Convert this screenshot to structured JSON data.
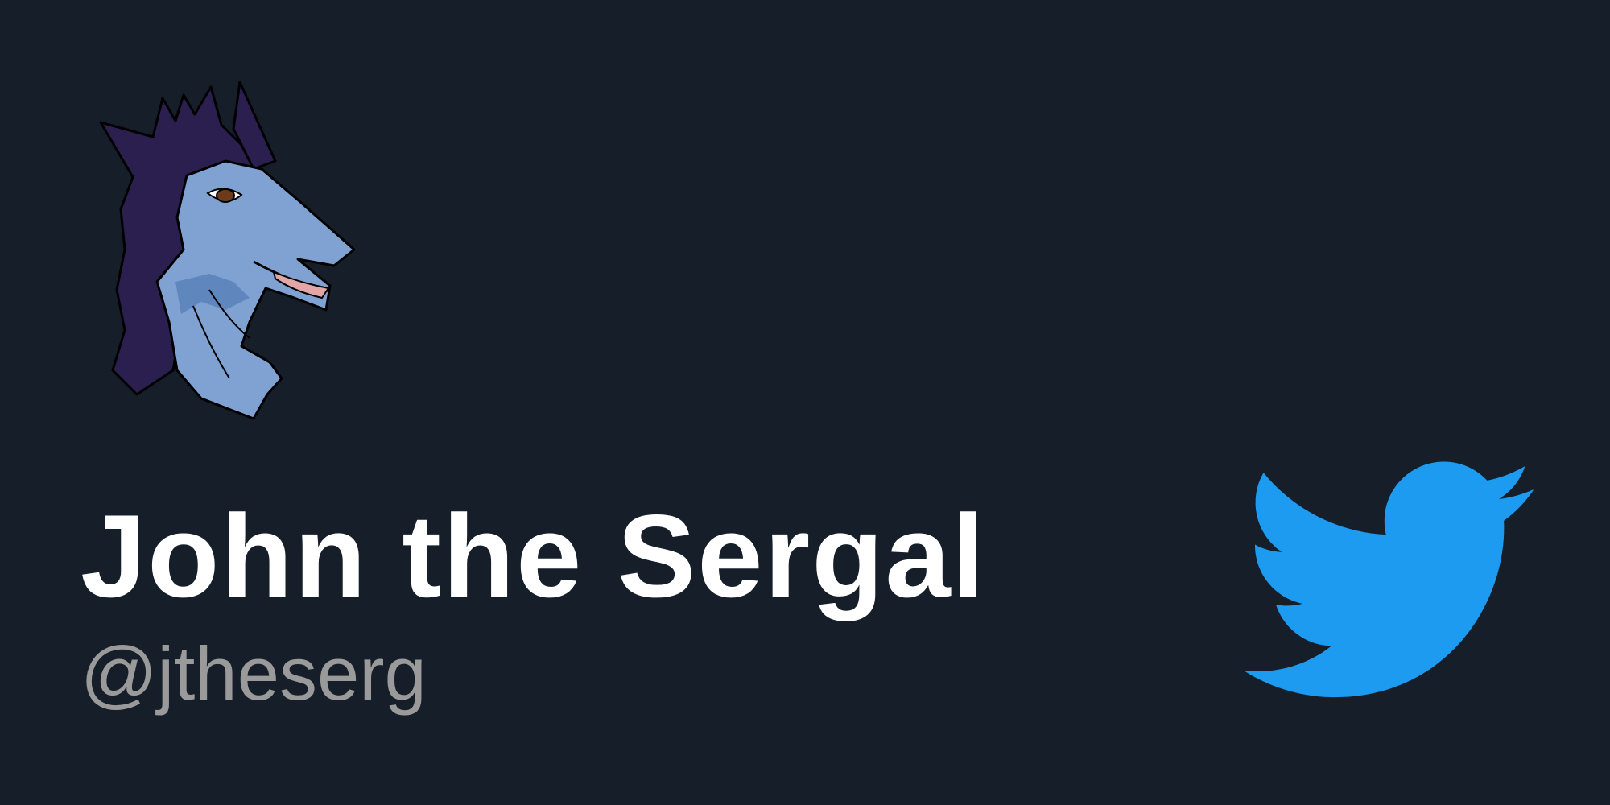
{
  "profile": {
    "display_name": "John the Sergal",
    "handle": "@jtheserg",
    "avatar_icon": "sergal-avatar-icon"
  },
  "brand": {
    "icon": "twitter-bird-icon"
  },
  "colors": {
    "background": "#161f29",
    "name_text": "#ffffff",
    "handle_text": "#9a9a9a",
    "brand_blue": "#1d9bf0",
    "fur_dark": "#2a1f4e",
    "skin_light": "#7fa2d2",
    "skin_shadow": "#5f87bd"
  }
}
